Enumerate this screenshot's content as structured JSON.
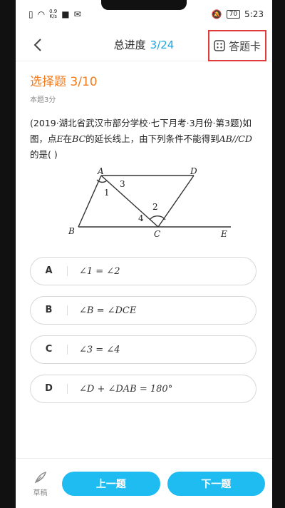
{
  "status_bar": {
    "net_speed": "0.9\nK/s",
    "battery": "70",
    "time": "5:23"
  },
  "header": {
    "progress_label": "总进度",
    "progress_value": "3/24",
    "answer_card_label": "答题卡"
  },
  "question": {
    "type_label": "选择题 3/10",
    "score_label": "本题3分",
    "source": "(2019·湖北省武汉市部分学校·七下月考·3月份·第3题)",
    "text_part1": "如图，点",
    "var_e": "E",
    "text_part2": "在",
    "var_bc": "BC",
    "text_part3": "的延长线上，由下列条件不能得到",
    "var_ab_cd": "AB//CD",
    "text_part4": "的是(   )"
  },
  "figure": {
    "labels": {
      "A": "A",
      "B": "B",
      "C": "C",
      "D": "D",
      "E": "E",
      "angle1": "1",
      "angle2": "2",
      "angle3": "3",
      "angle4": "4"
    }
  },
  "options": [
    {
      "letter": "A",
      "text": "∠1 = ∠2"
    },
    {
      "letter": "B",
      "text": "∠B = ∠DCE"
    },
    {
      "letter": "C",
      "text": "∠3 = ∠4"
    },
    {
      "letter": "D",
      "text": "∠D + ∠DAB = 180°"
    }
  ],
  "bottom": {
    "draft_label": "草稿",
    "prev_label": "上一题",
    "next_label": "下一题"
  },
  "colors": {
    "accent_blue": "#1ebcf0",
    "question_type_orange": "#f07a1c",
    "highlight_red": "#e23a3a"
  }
}
